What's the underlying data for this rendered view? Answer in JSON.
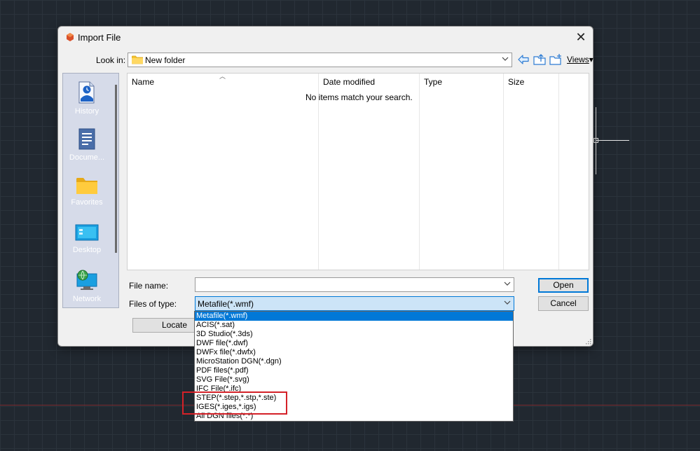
{
  "dialog": {
    "title": "Import File",
    "close_glyph": "✕",
    "look_in_label": "Look in:",
    "look_in_value": "New folder",
    "view_label": "Views",
    "view_arrow": "▾"
  },
  "places": [
    {
      "label": "History",
      "icon": "history-icon"
    },
    {
      "label": "Docume...",
      "icon": "documents-icon"
    },
    {
      "label": "Favorites",
      "icon": "favorites-folder-icon"
    },
    {
      "label": "Desktop",
      "icon": "desktop-icon"
    },
    {
      "label": "Network",
      "icon": "network-icon"
    }
  ],
  "file_list": {
    "columns": [
      "Name",
      "Date modified",
      "Type",
      "Size"
    ],
    "empty_message": "No items match your search."
  },
  "form": {
    "file_name_label": "File name:",
    "file_name_value": "",
    "files_of_type_label": "Files of type:",
    "files_of_type_value": "Metafile(*.wmf)",
    "open_label": "Open",
    "cancel_label": "Cancel",
    "locate_label": "Locate"
  },
  "file_types": [
    "Metafile(*.wmf)",
    "ACIS(*.sat)",
    "3D Studio(*.3ds)",
    "DWF file(*.dwf)",
    "DWFx file(*.dwfx)",
    "MicroStation DGN(*.dgn)",
    "PDF files(*.pdf)",
    "SVG File(*.svg)",
    "IFC File(*.ifc)",
    "STEP(*.step,*.stp,*.ste)",
    "IGES(*.iges,*.igs)",
    "All DGN files(*.*)"
  ],
  "colors": {
    "accent": "#0078d7",
    "highlight_box": "#d42128",
    "canvas_bg": "#212830"
  }
}
